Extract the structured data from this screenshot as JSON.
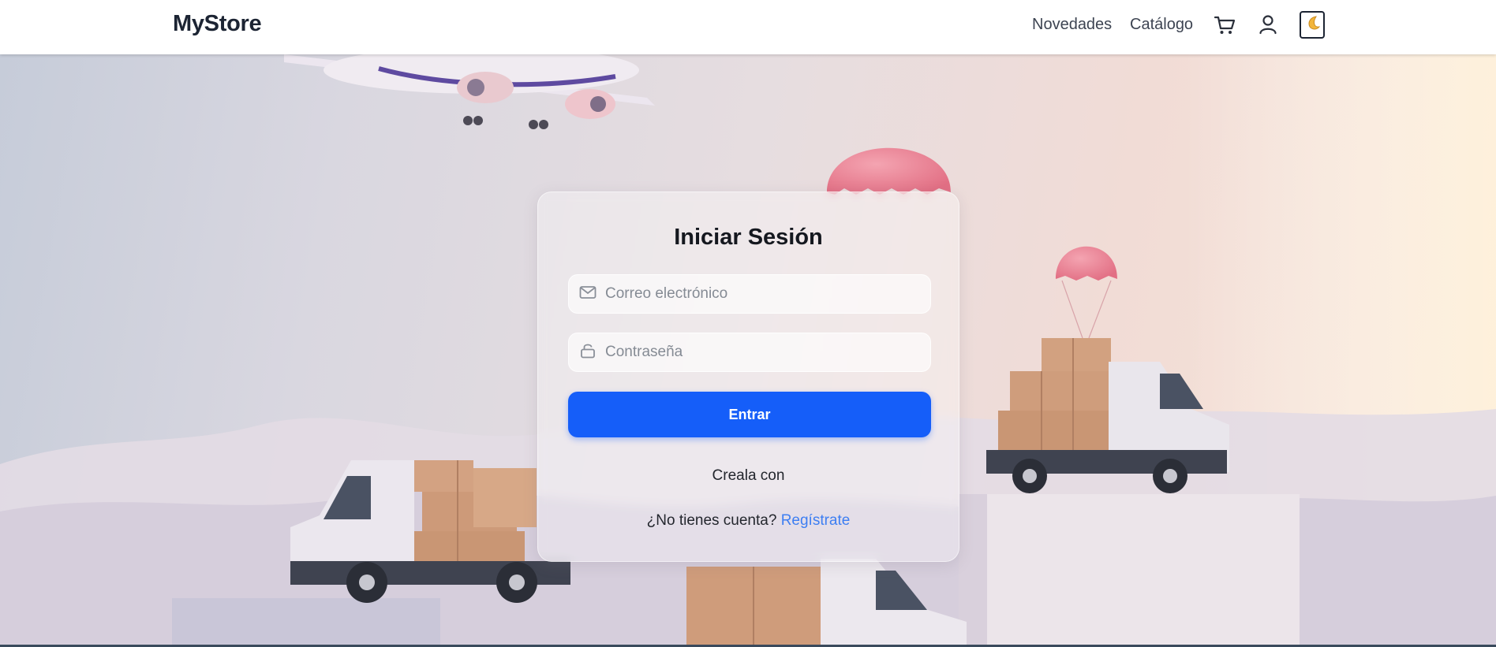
{
  "navbar": {
    "brand": "MyStore",
    "links": [
      "Novedades",
      "Catálogo"
    ],
    "icons": [
      "cart-icon",
      "user-icon",
      "moon-icon"
    ]
  },
  "login": {
    "title": "Iniciar Sesión",
    "email_placeholder": "Correo electrónico",
    "password_placeholder": "Contraseña",
    "submit_label": "Entrar",
    "social_text": "Creala con",
    "register_prompt": "¿No tienes cuenta?",
    "register_link": "Regístrate"
  },
  "colors": {
    "primary": "#155ef9",
    "link": "#3d7ef2",
    "brand_text": "#1c2433"
  }
}
